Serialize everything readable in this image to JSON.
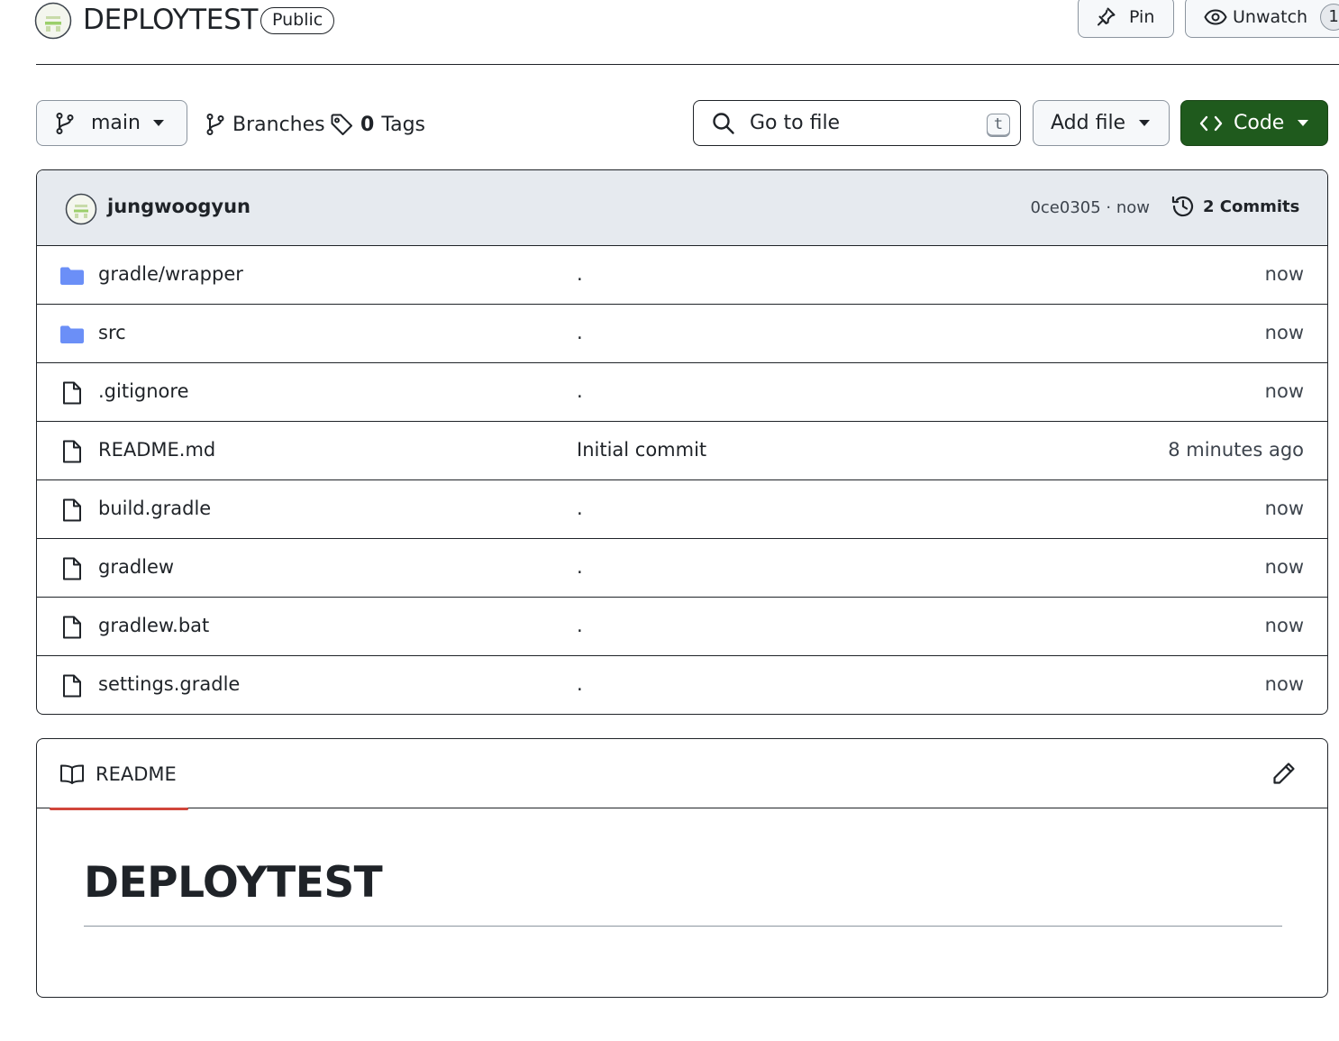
{
  "repo": {
    "name": "DEPLOYTEST",
    "visibility": "Public",
    "pin_label": "Pin",
    "unwatch_label": "Unwatch",
    "watchers_count": "1"
  },
  "toolbar": {
    "branch": "main",
    "branches_label": "Branches",
    "tags_count": "0",
    "tags_label": "Tags",
    "goto_placeholder": "Go to file",
    "goto_shortcut": "t",
    "add_file_label": "Add file",
    "code_label": "Code"
  },
  "latest_commit": {
    "author": "jungwoogyun",
    "message": ".",
    "meta": "0ce0305 · now",
    "commits_label": "2 Commits"
  },
  "files": [
    {
      "name": "gradle/wrapper",
      "type": "folder",
      "message": ".",
      "time": "now"
    },
    {
      "name": "src",
      "type": "folder",
      "message": ".",
      "time": "now"
    },
    {
      "name": ".gitignore",
      "type": "file",
      "message": ".",
      "time": "now"
    },
    {
      "name": "README.md",
      "type": "file",
      "message": "Initial commit",
      "time": "8 minutes ago"
    },
    {
      "name": "build.gradle",
      "type": "file",
      "message": ".",
      "time": "now"
    },
    {
      "name": "gradlew",
      "type": "file",
      "message": ".",
      "time": "now"
    },
    {
      "name": "gradlew.bat",
      "type": "file",
      "message": ".",
      "time": "now"
    },
    {
      "name": "settings.gradle",
      "type": "file",
      "message": ".",
      "time": "now"
    }
  ],
  "readme": {
    "tab_label": "README",
    "heading": "DEPLOYTEST"
  },
  "colors": {
    "code_button": "#1f5a1d",
    "folder_icon": "#54aeff",
    "readme_tab_underline": "#d1463b",
    "commit_bar_bg": "#e6eaef"
  }
}
